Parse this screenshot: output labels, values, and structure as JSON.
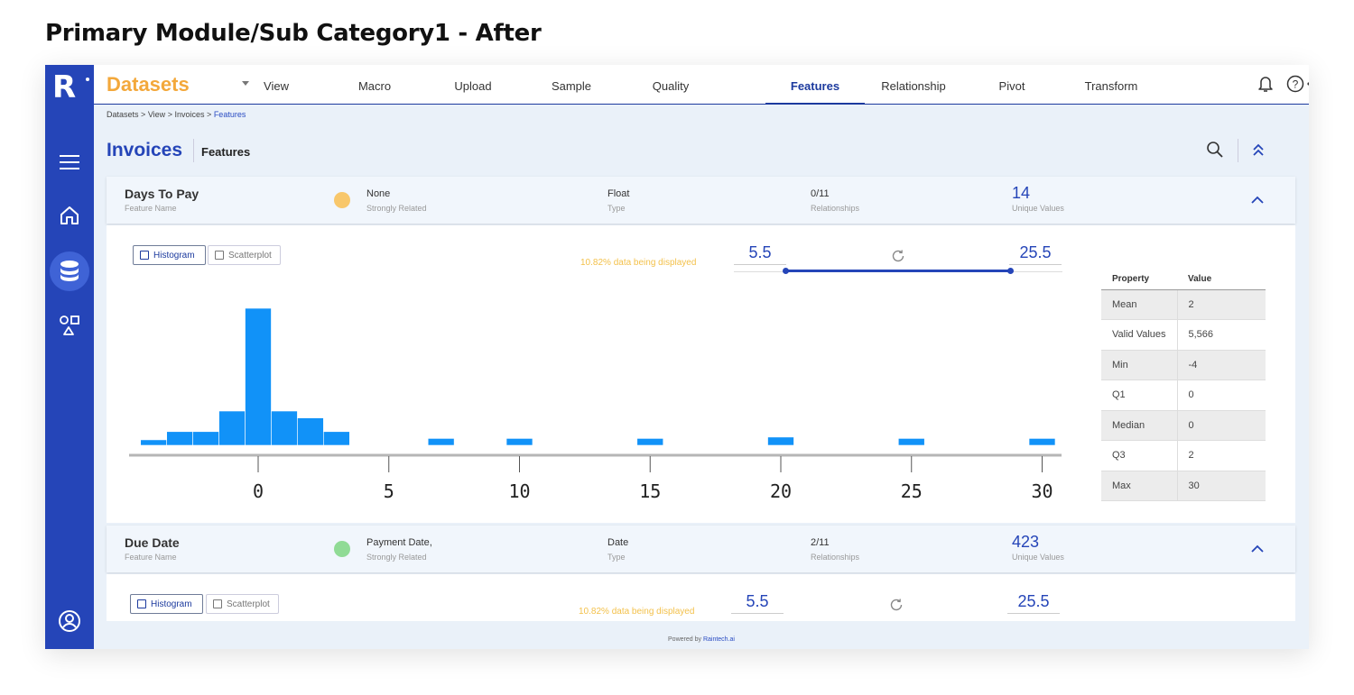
{
  "page_title": "Primary Module/Sub Category1 - After",
  "app": {
    "logo_letter": "R",
    "brand": "Datasets",
    "nav_tabs": [
      "View",
      "Macro",
      "Upload",
      "Sample",
      "Quality",
      "Features",
      "Relationship",
      "Pivot",
      "Transform"
    ],
    "active_tab": "Features"
  },
  "breadcrumb": {
    "items": [
      "Datasets",
      "View",
      "Invoices"
    ],
    "current": "Features",
    "separator": ">"
  },
  "header": {
    "title": "Invoices",
    "subtitle": "Features"
  },
  "features": [
    {
      "name": "Days To Pay",
      "name_caption": "Feature Name",
      "related": "None",
      "related_caption": "Strongly Related",
      "related_color": "#f8c76b",
      "type": "Float",
      "type_caption": "Type",
      "relationships": "0/11",
      "relationships_caption": "Relationships",
      "unique": "14",
      "unique_caption": "Unique Values",
      "view_tabs": [
        "Histogram",
        "Scatterplot"
      ],
      "active_view": "Histogram",
      "display_note": "10.82% data being displayed",
      "range_min": "5.5",
      "range_max": "25.5",
      "stats_headers": [
        "Property",
        "Value"
      ],
      "stats": [
        {
          "property": "Mean",
          "value": "2"
        },
        {
          "property": "Valid Values",
          "value": "5,566"
        },
        {
          "property": "Min",
          "value": "-4"
        },
        {
          "property": "Q1",
          "value": "0"
        },
        {
          "property": "Median",
          "value": "0"
        },
        {
          "property": "Q3",
          "value": "2"
        },
        {
          "property": "Max",
          "value": "30"
        }
      ]
    },
    {
      "name": "Due Date",
      "name_caption": "Feature Name",
      "related": "Payment Date,",
      "related_caption": "Strongly Related",
      "related_color": "#90db95",
      "type": "Date",
      "type_caption": "Type",
      "relationships": "2/11",
      "relationships_caption": "Relationships",
      "unique": "423",
      "unique_caption": "Unique Values",
      "view_tabs": [
        "Histogram",
        "Scatterplot"
      ],
      "active_view": "Histogram",
      "display_note": "10.82% data being displayed",
      "range_min": "5.5",
      "range_max": "25.5"
    }
  ],
  "chart_data": {
    "type": "bar",
    "bar_color": "#1192f8",
    "x_ticks": [
      0,
      5,
      10,
      15,
      20,
      25,
      30
    ],
    "xlim": [
      -5,
      31
    ],
    "ylim": [
      0,
      100
    ],
    "bins": [
      {
        "x0": -4.5,
        "x1": -3.5,
        "value": 4
      },
      {
        "x0": -3.5,
        "x1": -2.5,
        "value": 10
      },
      {
        "x0": -2.5,
        "x1": -1.5,
        "value": 10
      },
      {
        "x0": -1.5,
        "x1": -0.5,
        "value": 25
      },
      {
        "x0": -0.5,
        "x1": 0.5,
        "value": 100
      },
      {
        "x0": 0.5,
        "x1": 1.5,
        "value": 25
      },
      {
        "x0": 1.5,
        "x1": 2.5,
        "value": 20
      },
      {
        "x0": 2.5,
        "x1": 3.5,
        "value": 10
      },
      {
        "x0": 6.5,
        "x1": 7.5,
        "value": 5
      },
      {
        "x0": 9.5,
        "x1": 10.5,
        "value": 5
      },
      {
        "x0": 14.5,
        "x1": 15.5,
        "value": 5
      },
      {
        "x0": 19.5,
        "x1": 20.5,
        "value": 6
      },
      {
        "x0": 24.5,
        "x1": 25.5,
        "value": 5
      },
      {
        "x0": 29.5,
        "x1": 30.5,
        "value": 5
      }
    ],
    "grid": false
  },
  "footer": {
    "prefix": "Powered by",
    "link": "Raintech.ai"
  },
  "icons": {
    "sidebar": [
      "menu-icon",
      "home-icon",
      "database-icon",
      "shapes-icon",
      "user-circle-icon"
    ],
    "topbar": [
      "bell-icon",
      "help-icon",
      "theme-icon"
    ],
    "header": [
      "search-icon",
      "collapse-all-icon"
    ]
  },
  "colors": {
    "brand": "#f3a83b",
    "primary": "#2545b8",
    "sidebar": "#2545b8",
    "note": "#f3c14b"
  }
}
